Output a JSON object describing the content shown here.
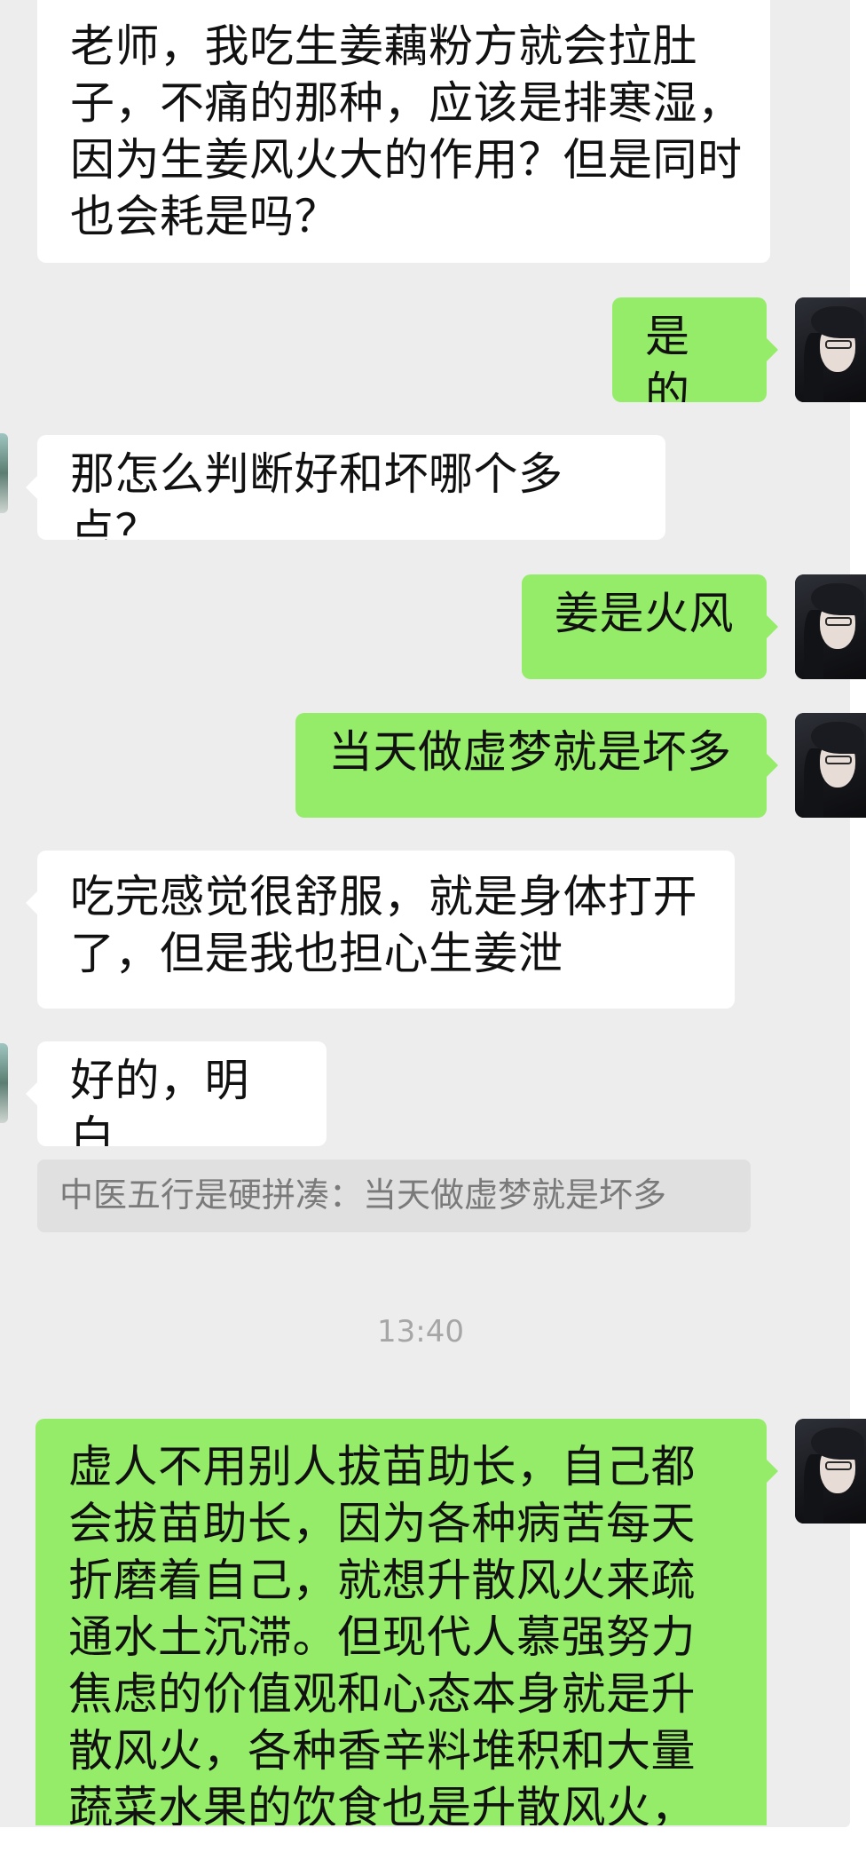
{
  "messages": [
    {
      "from": "incoming",
      "text": "老师，我吃生姜藕粉方就会拉肚子，不痛的那种，应该是排寒湿，因为生姜风火大的作用？但是同时也会耗是吗？"
    },
    {
      "from": "outgoing",
      "text": "是的"
    },
    {
      "from": "incoming",
      "text": "那怎么判断好和坏哪个多点？"
    },
    {
      "from": "outgoing",
      "text": "姜是火风"
    },
    {
      "from": "outgoing",
      "text": "当天做虚梦就是坏多"
    },
    {
      "from": "incoming",
      "text": "吃完感觉很舒服，就是身体打开了，但是我也担心生姜泄"
    },
    {
      "from": "incoming",
      "text": "好的，明白"
    },
    {
      "from": "outgoing",
      "text": "虚人不用别人拔苗助长，自己都会拔苗助长，因为各种病苦每天折磨着自己，就想升散风火来疏通水土沉滞。但现代人慕强努力焦虑的价值观和心态本身就是升散风火，各种香辛料堆积和大量蔬菜水果的饮食也是升散风火，应该敛降风火节"
    }
  ],
  "quote": "中医五行是硬拼凑：当天做虚梦就是坏多",
  "timestamp": "13:40",
  "colors": {
    "background": "#ededed",
    "incoming_bubble": "#ffffff",
    "outgoing_bubble": "#95ec69",
    "quote_bg": "#e0e0e0",
    "quote_text": "#7a7a7a",
    "timestamp_text": "#a6a6a6"
  },
  "icons": {
    "self_avatar": "user-avatar-photo",
    "contact_avatar": "contact-avatar-photo"
  }
}
